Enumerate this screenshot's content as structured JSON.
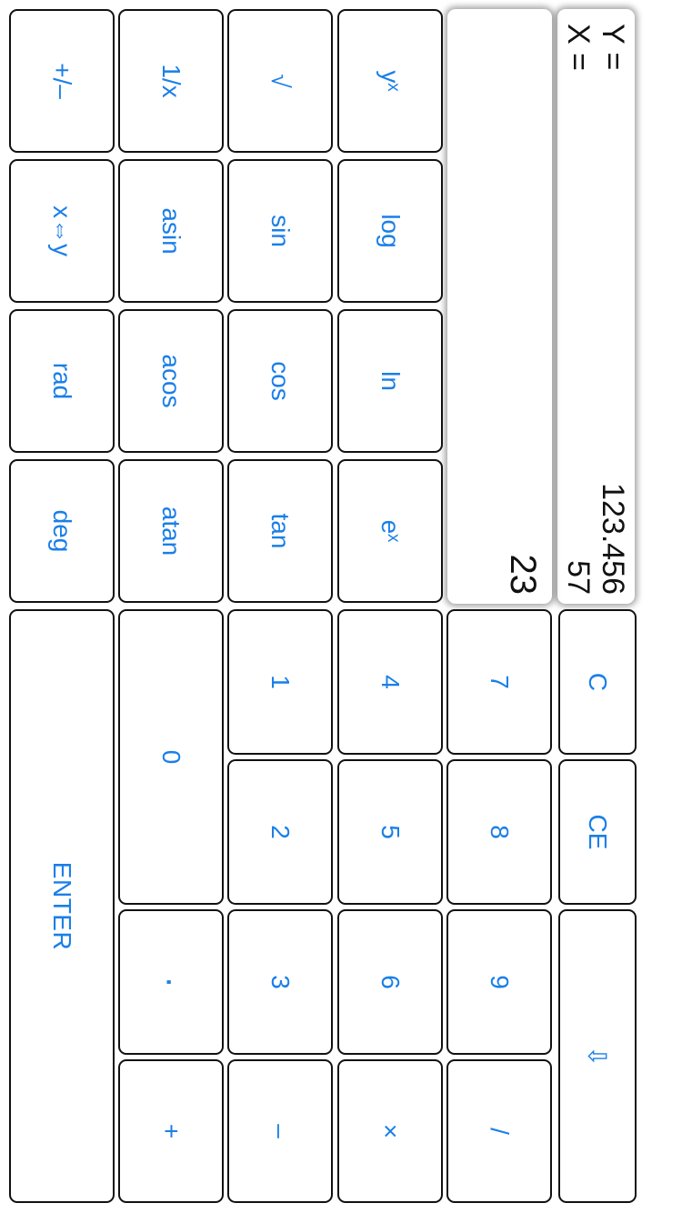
{
  "registers": {
    "y_label": "Y =",
    "y_value": "123.456",
    "x_label": "X =",
    "x_value": "57"
  },
  "entry_value": "23",
  "keys": {
    "c": "C",
    "ce": "CE",
    "backspace": "⇩",
    "seven": "7",
    "eight": "8",
    "nine": "9",
    "divide": "/",
    "four": "4",
    "five": "5",
    "six": "6",
    "multiply": "×",
    "one": "1",
    "two": "2",
    "three": "3",
    "minus": "–",
    "zero": "0",
    "point": "·",
    "plus": "+",
    "enter": "ENTER",
    "ytox": "yˣ",
    "log": "log",
    "ln": "ln",
    "ex": "eˣ",
    "sqrt": "√",
    "sin": "sin",
    "cos": "cos",
    "tan": "tan",
    "recip": "1/x",
    "asin": "asin",
    "acos": "acos",
    "atan": "atan",
    "negate": "+/–",
    "swap": "x⇔y",
    "rad": "rad",
    "deg": "deg"
  },
  "colors": {
    "key_text": "#1a7fe8",
    "key_border": "#111111",
    "display_text": "#111111"
  }
}
